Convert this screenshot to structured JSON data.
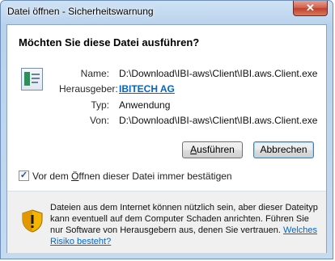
{
  "window": {
    "title": "Datei öffnen - Sicherheitswarnung",
    "close_glyph": "✕"
  },
  "dialog": {
    "heading": "Möchten Sie diese Datei ausführen?",
    "fields": [
      {
        "label": "Name:",
        "value": "D:\\Download\\IBI-aws\\Client\\IBI.aws.Client.exe"
      },
      {
        "label": "Herausgeber:",
        "value": "IBITECH AG"
      },
      {
        "label": "Typ:",
        "value": "Anwendung"
      },
      {
        "label": "Von:",
        "value": "D:\\Download\\IBI-aws\\Client\\IBI.aws.Client.exe"
      }
    ],
    "buttons": {
      "run_prefix": "",
      "run_accel": "A",
      "run_rest": "usführen",
      "cancel": "Abbrechen"
    },
    "checkbox": {
      "checked": true,
      "check_glyph": "✓",
      "label_prefix": "Vor dem ",
      "label_accel": "Ö",
      "label_rest": "ffnen dieser Datei immer bestätigen"
    },
    "warning": {
      "text": "Dateien aus dem Internet können nützlich sein, aber dieser Dateityp kann eventuell auf dem Computer Schaden anrichten. Führen Sie nur Software von Herausgebern aus, denen Sie vertrauen. ",
      "link": "Welches Risiko besteht?",
      "icon": "security-shield-icon"
    }
  }
}
